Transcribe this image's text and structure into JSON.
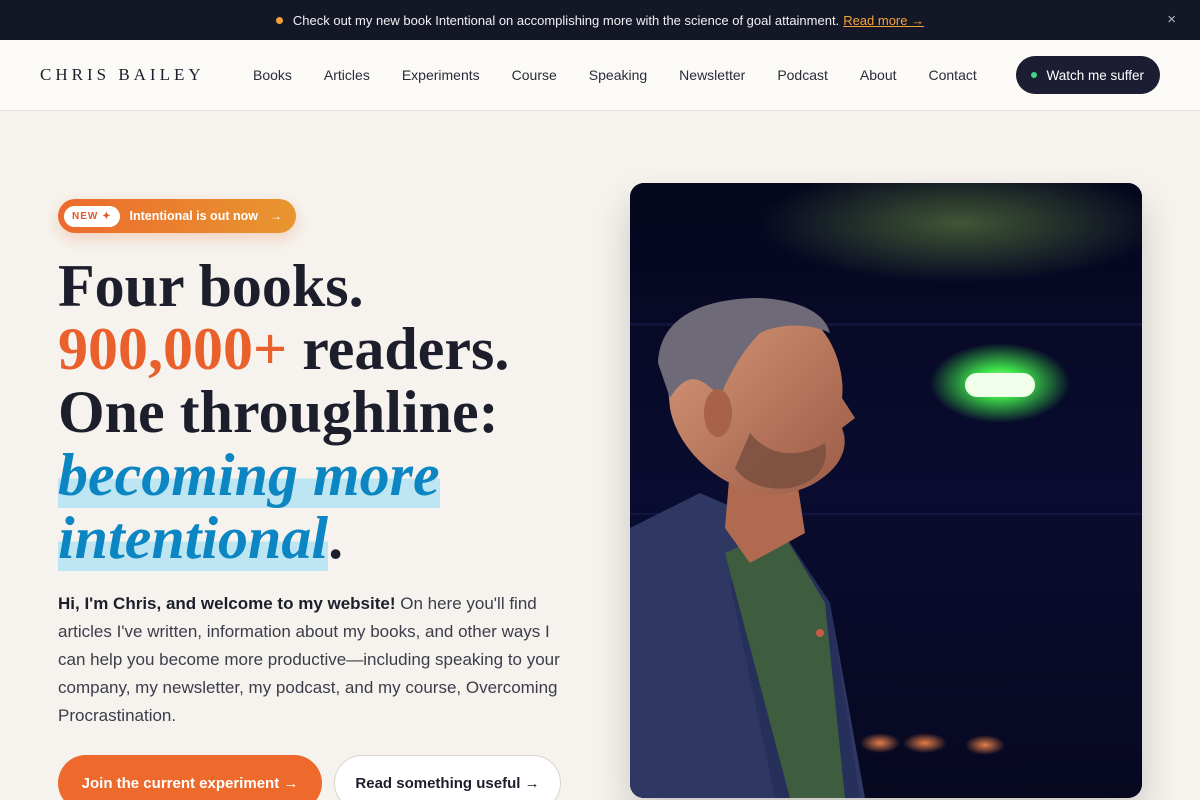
{
  "announcement": {
    "text": "Check out my new book Intentional on accomplishing more with the science of goal attainment.",
    "link": "Read more →",
    "close": "×"
  },
  "header": {
    "logo": "CHRIS BAILEY",
    "nav": [
      "Books",
      "Articles",
      "Experiments",
      "Course",
      "Speaking",
      "Newsletter",
      "Podcast",
      "About",
      "Contact"
    ],
    "cta": "Watch me suffer"
  },
  "hero": {
    "badge_new": "NEW ✦",
    "badge_text": "Intentional is out now",
    "badge_arrow": "→",
    "headline": {
      "line1": "Four books.",
      "line2_highlight": "900,000+",
      "line2_rest": " readers.",
      "line3": "One throughline:",
      "line4": "becoming more",
      "line5": "intentional",
      "line5_end": "."
    },
    "intro_bold": "Hi, I'm Chris, and welcome to my website!",
    "intro_rest": " On here you'll find articles I've written, information about my books, and other ways I can help you become more productive—including speaking to your company, my newsletter, my podcast, and my course, Overcoming Procrastination.",
    "primary_button": "Join the current experiment →",
    "secondary_button": "Read something useful →"
  },
  "colors": {
    "accent_orange": "#ed6a2c",
    "accent_blue": "#0b86c2",
    "dark": "#1c1d33"
  }
}
